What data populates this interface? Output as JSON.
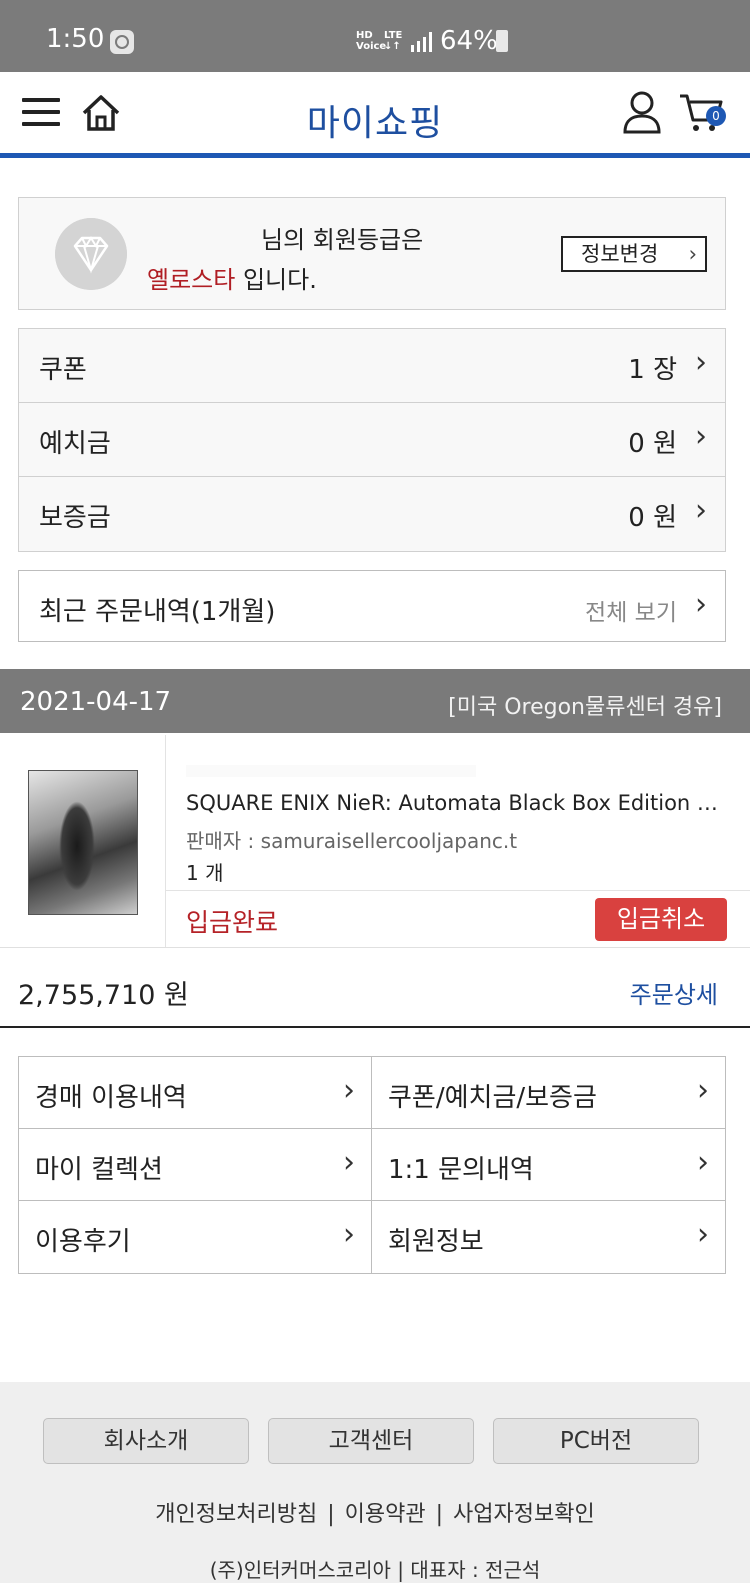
{
  "status_bar": {
    "time": "1:50",
    "network_top": "HD",
    "network_top_sub": "Voice",
    "lte": "LTE",
    "lte_sub": "↓↑",
    "battery": "64%"
  },
  "header": {
    "title": "마이쇼핑",
    "cart_count": "0",
    "accent_color": "#1e58b4"
  },
  "member": {
    "line1_suffix": "님의 회원등급은",
    "grade": "옐로스타",
    "line2_suffix": " 입니다.",
    "info_button": "정보변경"
  },
  "stats": [
    {
      "label": "쿠폰",
      "value": "1 장"
    },
    {
      "label": "예치금",
      "value": "0 원"
    },
    {
      "label": "보증금",
      "value": "0 원"
    }
  ],
  "recent_orders": {
    "label": "최근 주문내역(1개월)",
    "view_all": "전체 보기"
  },
  "order": {
    "date": "2021-04-17",
    "route": "[미국 Oregon물류센터 경유]",
    "item": {
      "title": "SQUARE ENIX NieR: Automata Black Box Edition Pl...",
      "seller": "판매자 : samuraisellercooljapanc.t",
      "quantity": "1 개",
      "status": "입금완료",
      "cancel_button": "입금취소"
    },
    "total": "2,755,710 원",
    "detail_link": "주문상세"
  },
  "menu_grid": [
    {
      "label": "경매 이용내역"
    },
    {
      "label": "쿠폰/예치금/보증금"
    },
    {
      "label": "마이 컬렉션"
    },
    {
      "label": "1:1 문의내역"
    },
    {
      "label": "이용후기"
    },
    {
      "label": "회원정보"
    }
  ],
  "footer": {
    "buttons": [
      "회사소개",
      "고객센터",
      "PC버전"
    ],
    "links": [
      "개인정보처리방침",
      "이용약관",
      "사업자정보확인"
    ],
    "company": "(주)인터커머스코리아 | 대표자 : 전근석"
  }
}
